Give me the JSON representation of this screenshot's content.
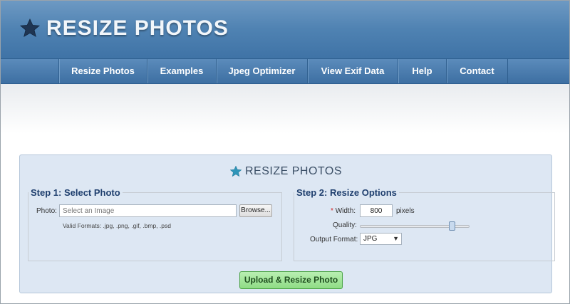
{
  "header": {
    "logo_text": "RESIZE PHOTOS"
  },
  "nav": {
    "items": [
      "Resize Photos",
      "Examples",
      "Jpeg Optimizer",
      "View Exif Data",
      "Help",
      "Contact"
    ]
  },
  "panel": {
    "title": "RESIZE PHOTOS",
    "step1": {
      "legend": "Step 1: Select Photo",
      "photo_label": "Photo:",
      "photo_placeholder": "Select an Image",
      "browse_label": "Browse...",
      "valid_formats": "Valid Formats: .jpg, .png, .gif, .bmp, .psd"
    },
    "step2": {
      "legend": "Step 2: Resize Options",
      "width_required_mark": "*",
      "width_label": "Width:",
      "width_value": "800",
      "width_unit": "pixels",
      "quality_label": "Quality:",
      "quality_value_fraction": 0.86,
      "output_label": "Output Format:",
      "output_value": "JPG"
    },
    "submit_label": "Upload & Resize Photo"
  },
  "colors": {
    "header_blue": "#4f82b2",
    "panel_bg": "#dde7f3",
    "submit_green": "#8fdc85",
    "star_dark": "#1f3552",
    "star_teal": "#2f95b8"
  },
  "icons": {
    "logo": "star-icon",
    "panel_title": "star-icon"
  }
}
